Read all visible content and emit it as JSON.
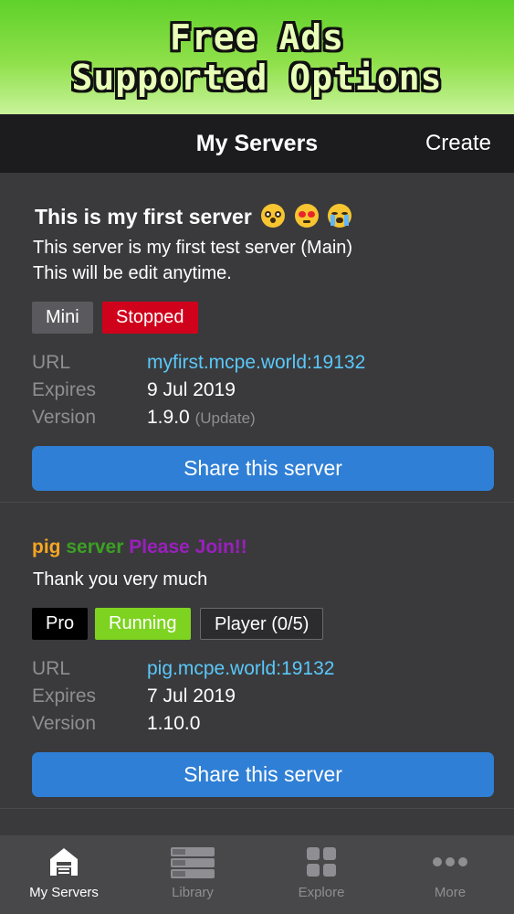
{
  "banner": {
    "line1": "Free Ads",
    "line2": "Supported Options"
  },
  "nav": {
    "title": "My Servers",
    "create_label": "Create"
  },
  "servers": [
    {
      "title": "This is my first server",
      "emojis": [
        "flushed-face",
        "heart-eyes-face",
        "loudly-crying-face"
      ],
      "description_line1": "This server is my first test server (Main)",
      "description_line2": "This will be edit anytime.",
      "badges": [
        "Mini",
        "Stopped"
      ],
      "url_label": "URL",
      "url": "myfirst.mcpe.world:19132",
      "expires_label": "Expires",
      "expires": "9 Jul 2019",
      "version_label": "Version",
      "version": "1.9.0",
      "version_note": "(Update)",
      "share_label": "Share this server"
    },
    {
      "title_parts": [
        "pig",
        "server",
        "Please Join!!"
      ],
      "title_colors": [
        "#f5a623",
        "#3ca023",
        "#9b1fbe"
      ],
      "description_line1": "Thank you very much",
      "badges": [
        "Pro",
        "Running",
        "Player (0/5)"
      ],
      "url_label": "URL",
      "url": "pig.mcpe.world:19132",
      "expires_label": "Expires",
      "expires": "7 Jul 2019",
      "version_label": "Version",
      "version": "1.10.0",
      "share_label": "Share this server"
    }
  ],
  "tabbar": {
    "tabs": [
      {
        "label": "My Servers",
        "icon": "house-icon",
        "active": true
      },
      {
        "label": "Library",
        "icon": "stack-icon",
        "active": false
      },
      {
        "label": "Explore",
        "icon": "grid-icon",
        "active": false
      },
      {
        "label": "More",
        "icon": "dots-icon",
        "active": false
      }
    ]
  },
  "colors": {
    "accent_button": "#2f7fd6",
    "link": "#5ac8fa",
    "stopped": "#d0021b",
    "running": "#7ed321"
  }
}
